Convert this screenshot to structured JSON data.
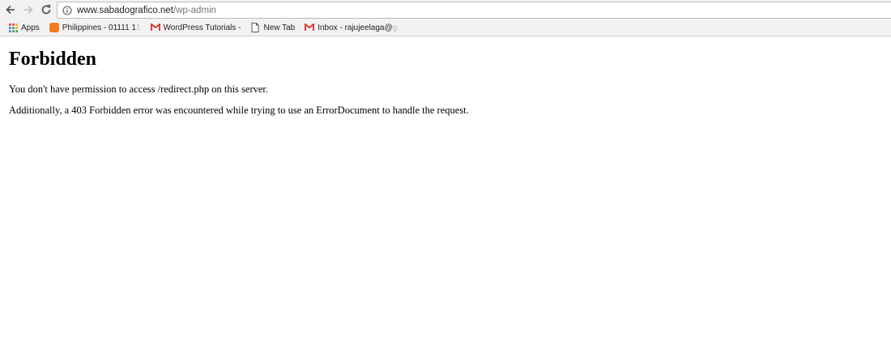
{
  "browser": {
    "url_host": "www.sabadografico.net",
    "url_path": "/wp-admin",
    "bookmarks": [
      {
        "label": "Apps",
        "icon": "apps-grid-icon"
      },
      {
        "label": "Philippines - 01111 1",
        "faded": "1",
        "icon": "orange-site-icon"
      },
      {
        "label": "WordPress Tutorials -",
        "icon": "gmail-icon"
      },
      {
        "label": "New Tab",
        "icon": "page-icon"
      },
      {
        "label": "Inbox - rajujeelaga@",
        "faded": "g",
        "icon": "gmail-icon"
      }
    ]
  },
  "page": {
    "heading": "Forbidden",
    "message": "You don't have permission to access /redirect.php on this server.",
    "additional": "Additionally, a 403 Forbidden error was encountered while trying to use an ErrorDocument to handle the request."
  }
}
